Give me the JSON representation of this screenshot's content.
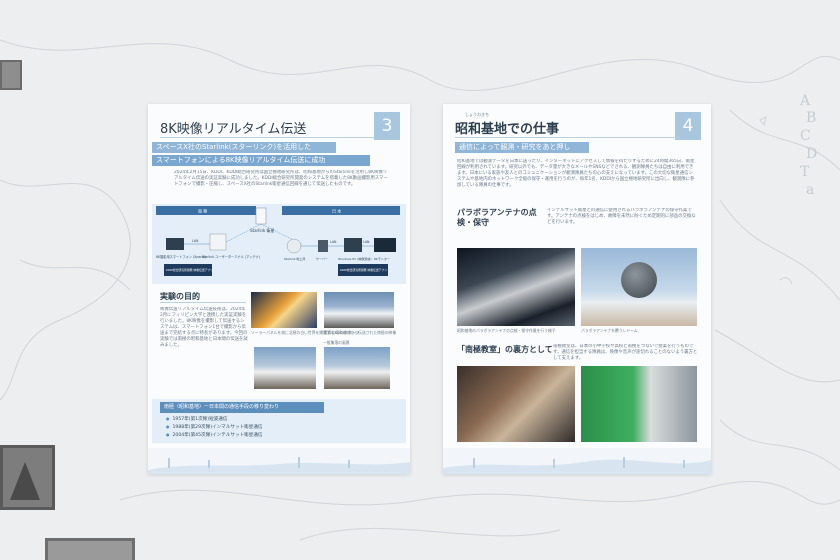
{
  "panel3": {
    "title": "8K映像リアルタイム伝送",
    "number": "3",
    "highlight_1": "スペースX社のStarlink(スターリンク)を活用した",
    "highlight_2": "スマートフォンによる8K映像リアルタイム伝送に成功",
    "intro": "2024年2月15日、KDDI、KDDI総合研究所は国立極地研究所は、昭和基地からのStarlinkを活用し8K映像リアルタイム伝送の実証実験に成功しました。KDDI総合研究所開発のシステムを搭載した8K動画撮影用スマートフォンで撮影・圧縮し、スペースX社のStarlink衛星通信回線を通じて伝送したものです。",
    "diagram": {
      "left_header": "南 極",
      "right_header": "日 本",
      "starlink_label": "Starlink 衛星",
      "left_items": [
        "8K撮影用スマートフォン (Xperia)",
        "Starlink ユーザーターミナル (アンテナ)"
      ],
      "left_box": "KDDI総合研究所開発 映像伝送アプリ",
      "right_items": [
        "Starlink 地上局",
        "サーバー",
        "Windows PC (映像受信)",
        "8Kモニター"
      ],
      "right_box": "KDDI総合研究所開発 映像伝送アプリ",
      "link_labels": [
        "LAN",
        "LAN",
        "LAN"
      ]
    },
    "purpose_heading": "実験の目的",
    "purpose_text": "映像伝送リアルタイム伝送技術は、2024年2月にフィリピン大学と連携した実証実験を行いました。8K映像を撮影して伝送するシステムは、スマートフォン1台で撮影から伝送まで完結する点に特長があります。今回の実験では南極の昭和基地と日本間の伝送を試みました。",
    "photo_caption_1": "ソーラーパネルを前に北極の白い世界を撮影するKDDIスタッフ",
    "photo_caption_2": "実際に昭和基地から伝送された南極の映像",
    "photo_caption_3": "一般集落の風景",
    "history_title": "南極〈昭和基地〉ー日本間の通信手段の移り変わり",
    "history": [
      "1957年(第1次隊)短波通信",
      "1988年(第29次隊)インマルサット衛星通信",
      "2004年(第45次隊)インテルサット衛星通信"
    ]
  },
  "panel4": {
    "title": "昭和基地での仕事",
    "ruby": "しょうわきち",
    "number": "4",
    "highlight": "通信によって観測・研究をあと押し",
    "intro": "昭和基地では観測データを日本に送ったり、インターネットにアクセスして情報を得たりするために24時間365日、衛星回線が利用されています。研究以外でも、データ量が大きなメールやSNSなどでされる、観測隊員たちは自由に利用できます。日本にいる家族や友人とのコミュニケーションが観測隊員たちの心の支えになっています。この大切な衛星通信システムや基地内のネットワーク全般の保守・運用を行うのが、毎年1名、KDDIから国立極地研究所に出向し、観測隊に参加している隊員の仕事です。",
    "section_1": "パラボラアンテナの点検・保守",
    "section_1_text": "インテルサット衛星との通信に使用されるパラボラアンテナの保守作業です。アンテナの点検をはじめ、故障を未然に防ぐため定期的に部品の交換などを行います。",
    "caption_1": "昭和基地のパラボラアンテナの点検・保守作業を行う様子",
    "caption_2": "パラボラアンテナを覆うレドーム",
    "section_2": "「南極教室」の裏方として",
    "section_2_text": "南極教室は、日本の小中学校や高校と南極をつないで授業を行うものです。通信を担当する隊員は、映像や音声が途切れることのないよう裏方として支えます。"
  }
}
